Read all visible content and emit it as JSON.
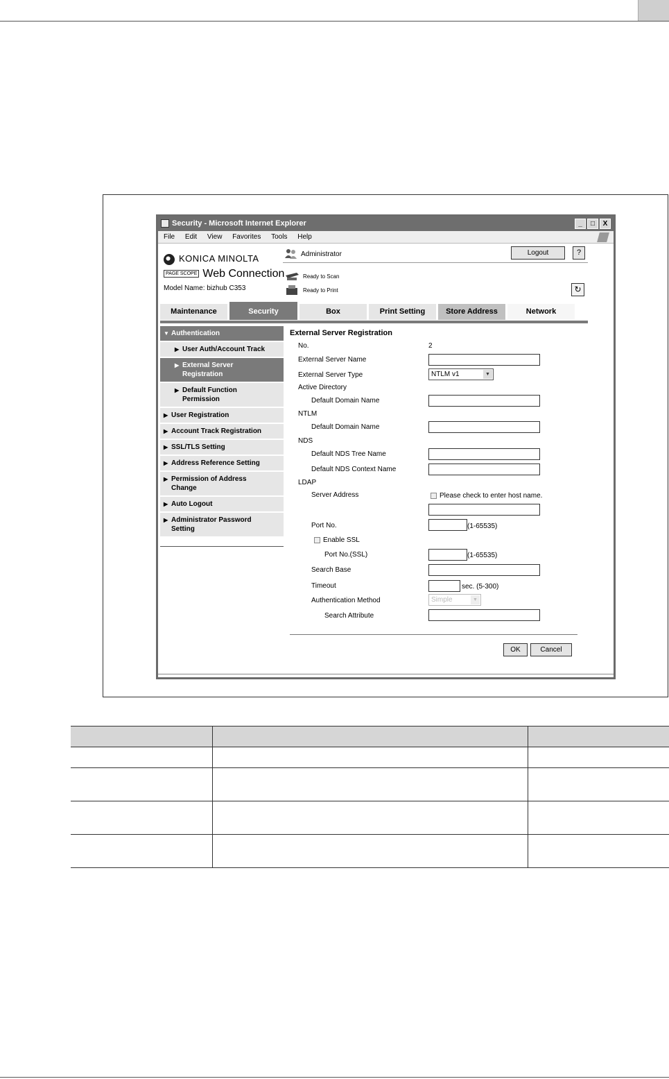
{
  "window": {
    "title": "Security - Microsoft Internet Explorer",
    "buttons": {
      "minimize": "_",
      "maximize": "□",
      "close": "X"
    }
  },
  "menubar": {
    "items": [
      "File",
      "Edit",
      "View",
      "Favorites",
      "Tools",
      "Help"
    ]
  },
  "header": {
    "brand": "KONICA MINOLTA",
    "pagescope": "PAGE SCOPE",
    "product": "Web Connection",
    "model": "Model Name: bizhub C353",
    "user": "Administrator",
    "logout_label": "Logout",
    "help_label": "?",
    "scan_status": "Ready to Scan",
    "print_status": "Ready to Print",
    "refresh_label": "↻"
  },
  "tabs": [
    "Maintenance",
    "Security",
    "Box",
    "Print Setting",
    "Store Address",
    "Network"
  ],
  "sidebar": {
    "items": [
      {
        "label": "Authentication",
        "arrow": "▼"
      },
      {
        "label": "User Auth/Account Track",
        "arrow": "▶"
      },
      {
        "label": "External Server Registration",
        "arrow": "▶"
      },
      {
        "label": "Default Function Permission",
        "arrow": "▶"
      },
      {
        "label": "User Registration",
        "arrow": "▶"
      },
      {
        "label": "Account Track Registration",
        "arrow": "▶"
      },
      {
        "label": "SSL/TLS Setting",
        "arrow": "▶"
      },
      {
        "label": "Address Reference Setting",
        "arrow": "▶"
      },
      {
        "label": "Permission of Address Change",
        "arrow": "▶"
      },
      {
        "label": "Auto Logout",
        "arrow": "▶"
      },
      {
        "label": "Administrator Password Setting",
        "arrow": "▶"
      }
    ]
  },
  "form": {
    "title": "External Server Registration",
    "no_label": "No.",
    "no_value": "2",
    "server_name_label": "External Server Name",
    "server_type_label": "External Server Type",
    "server_type_value": "NTLM v1",
    "active_directory_label": "Active Directory",
    "ad_domain_label": "Default Domain Name",
    "ntlm_label": "NTLM",
    "ntlm_domain_label": "Default Domain Name",
    "nds_label": "NDS",
    "nds_tree_label": "Default NDS Tree Name",
    "nds_context_label": "Default NDS Context Name",
    "ldap_label": "LDAP",
    "server_address_label": "Server Address",
    "host_check_label": "Please check to enter host name.",
    "port_label": "Port No.",
    "port_range": "(1-65535)",
    "ssl_label": "Enable SSL",
    "ssl_port_label": "Port No.(SSL)",
    "ssl_port_range": "(1-65535)",
    "search_base_label": "Search Base",
    "timeout_label": "Timeout",
    "timeout_range": "sec. (5-300)",
    "auth_method_label": "Authentication Method",
    "auth_method_value": "Simple",
    "search_attr_label": "Search Attribute",
    "ok_label": "OK",
    "cancel_label": "Cancel"
  }
}
